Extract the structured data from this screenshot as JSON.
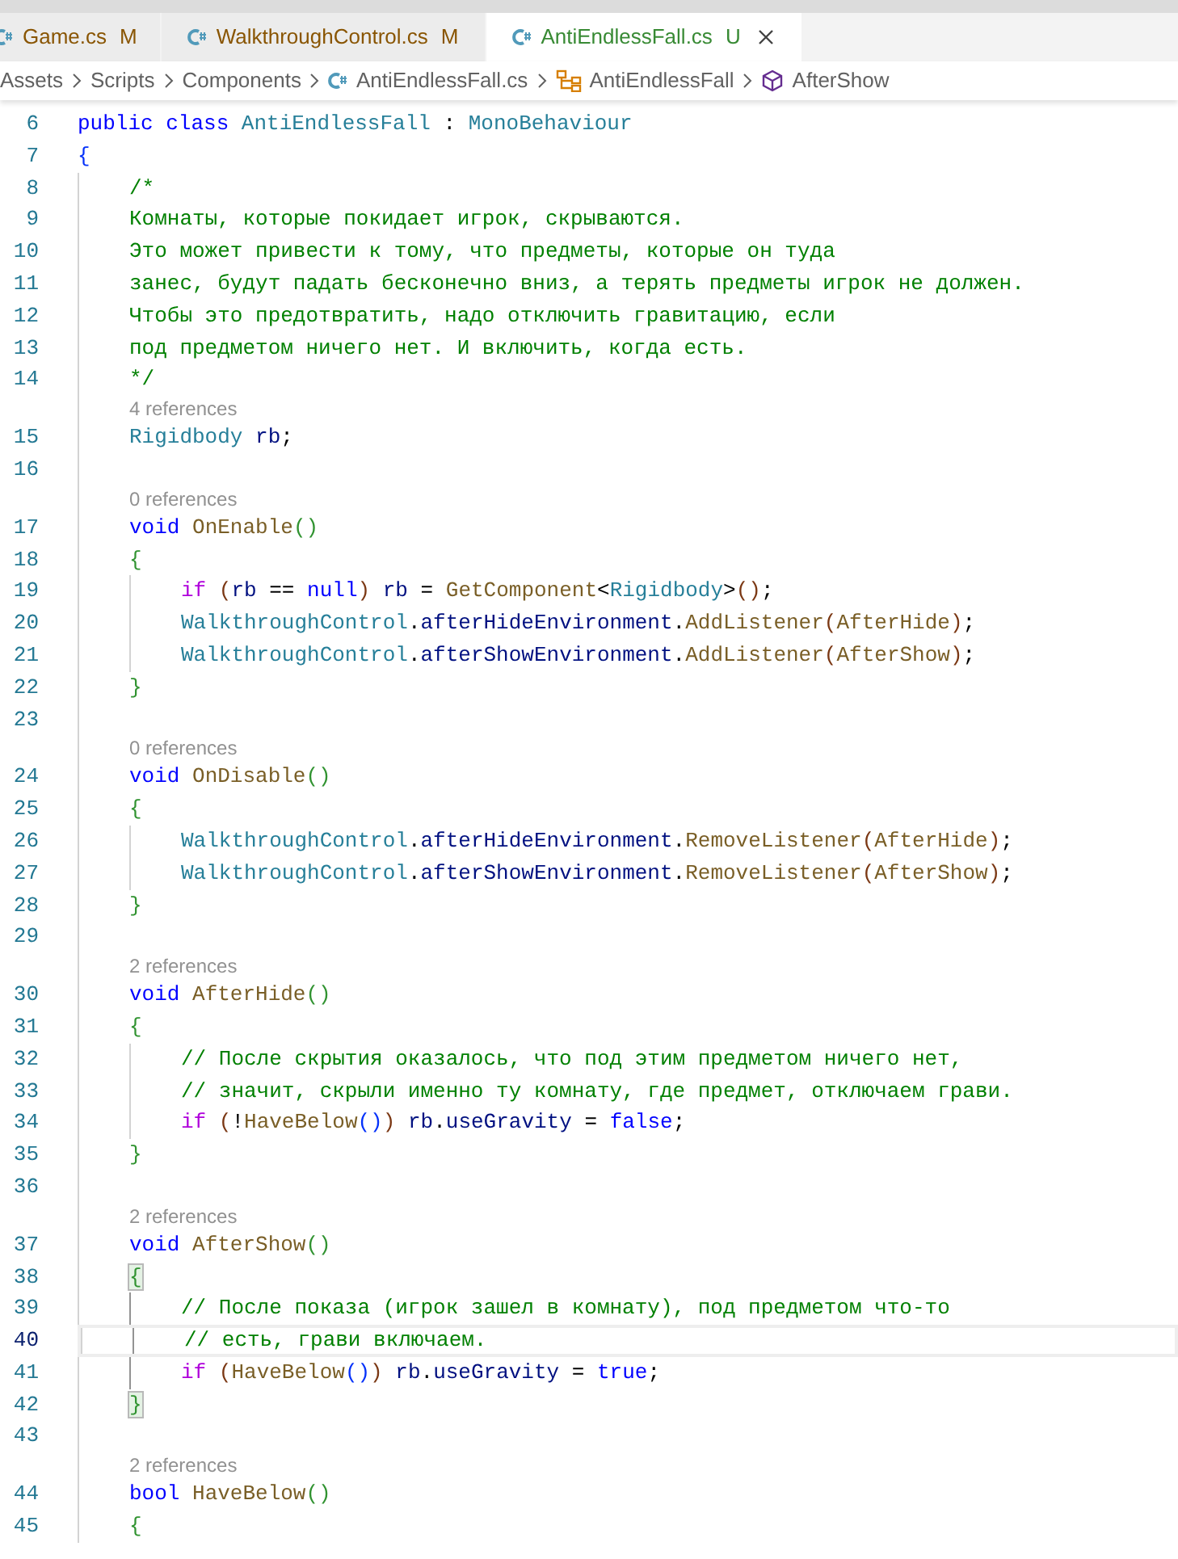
{
  "tabs": [
    {
      "label": "Game.cs",
      "status": "M",
      "kind": "modified",
      "selected": false
    },
    {
      "label": "WalkthroughControl.cs",
      "status": "M",
      "kind": "modified",
      "selected": false
    },
    {
      "label": "AntiEndlessFall.cs",
      "status": "U",
      "kind": "untracked",
      "selected": true
    }
  ],
  "breadcrumb": [
    {
      "label": "Assets",
      "kind": "folder"
    },
    {
      "label": "Scripts",
      "kind": "folder"
    },
    {
      "label": "Components",
      "kind": "folder"
    },
    {
      "label": "AntiEndlessFall.cs",
      "kind": "file"
    },
    {
      "label": "AntiEndlessFall",
      "kind": "class"
    },
    {
      "label": "AfterShow",
      "kind": "method"
    }
  ],
  "lines": [
    {
      "n": "6",
      "tokens": [
        {
          "kind": "k",
          "text": "public "
        },
        {
          "kind": "k",
          "text": "class "
        },
        {
          "kind": "t",
          "text": "AntiEndlessFall"
        },
        {
          "kind": "p",
          "text": " : "
        },
        {
          "kind": "t",
          "text": "MonoBehaviour"
        }
      ]
    },
    {
      "n": "7",
      "tokens": [
        {
          "kind": "b1",
          "text": "{"
        }
      ],
      "children": [
        {
          "n": "8",
          "tokens": [
            {
              "kind": "m",
              "text": "/*"
            }
          ]
        },
        {
          "n": "9",
          "tokens": [
            {
              "kind": "m",
              "text": "Комнаты, которые покидает игрок, скрываются."
            }
          ]
        },
        {
          "n": "10",
          "tokens": [
            {
              "kind": "m",
              "text": "Это может привести к тому, что предметы, которые он туда"
            }
          ]
        },
        {
          "n": "11",
          "tokens": [
            {
              "kind": "m",
              "text": "занес, будут падать бесконечно вниз, а терять предметы игрок не должен."
            }
          ]
        },
        {
          "n": "12",
          "tokens": [
            {
              "kind": "m",
              "text": "Чтобы это предотвратить, надо отключить гравитацию, если"
            }
          ]
        },
        {
          "n": "13",
          "tokens": [
            {
              "kind": "m",
              "text": "под предметом ничего нет. И включить, когда есть."
            }
          ]
        },
        {
          "n": "14",
          "tokens": [
            {
              "kind": "m",
              "text": "*/"
            }
          ]
        },
        {
          "n": "15",
          "references": "4 references",
          "tokens": [
            {
              "kind": "t",
              "text": "Rigidbody "
            },
            {
              "kind": "v",
              "text": "rb"
            },
            {
              "kind": "p",
              "text": ";"
            }
          ]
        },
        {
          "n": "16"
        },
        {
          "n": "17",
          "references": "0 references",
          "tokens": [
            {
              "kind": "k",
              "text": "void "
            },
            {
              "kind": "f",
              "text": "OnEnable"
            },
            {
              "kind": "b2",
              "text": "()"
            }
          ]
        },
        {
          "n": "18",
          "tokens": [
            {
              "kind": "b2",
              "text": "{"
            }
          ],
          "children": [
            {
              "n": "19",
              "tokens": [
                {
                  "kind": "c",
                  "text": "if "
                },
                {
                  "kind": "b3",
                  "text": "("
                },
                {
                  "kind": "v",
                  "text": "rb"
                },
                {
                  "kind": "p",
                  "text": " == "
                },
                {
                  "kind": "k",
                  "text": "null"
                },
                {
                  "kind": "b3",
                  "text": ") "
                },
                {
                  "kind": "v",
                  "text": "rb"
                },
                {
                  "kind": "p",
                  "text": " = "
                },
                {
                  "kind": "f",
                  "text": "GetComponent"
                },
                {
                  "kind": "p",
                  "text": "<"
                },
                {
                  "kind": "t",
                  "text": "Rigidbody"
                },
                {
                  "kind": "p",
                  "text": ">"
                },
                {
                  "kind": "b3",
                  "text": "()"
                },
                {
                  "kind": "p",
                  "text": ";"
                }
              ]
            },
            {
              "n": "20",
              "tokens": [
                {
                  "kind": "t",
                  "text": "WalkthroughControl"
                },
                {
                  "kind": "p",
                  "text": "."
                },
                {
                  "kind": "v",
                  "text": "afterHideEnvironment"
                },
                {
                  "kind": "p",
                  "text": "."
                },
                {
                  "kind": "f",
                  "text": "AddListener"
                },
                {
                  "kind": "b3",
                  "text": "("
                },
                {
                  "kind": "f",
                  "text": "AfterHide"
                },
                {
                  "kind": "b3",
                  "text": ")"
                },
                {
                  "kind": "p",
                  "text": ";"
                }
              ]
            },
            {
              "n": "21",
              "tokens": [
                {
                  "kind": "t",
                  "text": "WalkthroughControl"
                },
                {
                  "kind": "p",
                  "text": "."
                },
                {
                  "kind": "v",
                  "text": "afterShowEnvironment"
                },
                {
                  "kind": "p",
                  "text": "."
                },
                {
                  "kind": "f",
                  "text": "AddListener"
                },
                {
                  "kind": "b3",
                  "text": "("
                },
                {
                  "kind": "f",
                  "text": "AfterShow"
                },
                {
                  "kind": "b3",
                  "text": ")"
                },
                {
                  "kind": "p",
                  "text": ";"
                }
              ]
            }
          ]
        },
        {
          "n": "22",
          "tokens": [
            {
              "kind": "b2",
              "text": "}"
            }
          ]
        },
        {
          "n": "23"
        },
        {
          "n": "24",
          "references": "0 references",
          "tokens": [
            {
              "kind": "k",
              "text": "void "
            },
            {
              "kind": "f",
              "text": "OnDisable"
            },
            {
              "kind": "b2",
              "text": "()"
            }
          ]
        },
        {
          "n": "25",
          "tokens": [
            {
              "kind": "b2",
              "text": "{"
            }
          ],
          "children": [
            {
              "n": "26",
              "tokens": [
                {
                  "kind": "t",
                  "text": "WalkthroughControl"
                },
                {
                  "kind": "p",
                  "text": "."
                },
                {
                  "kind": "v",
                  "text": "afterHideEnvironment"
                },
                {
                  "kind": "p",
                  "text": "."
                },
                {
                  "kind": "f",
                  "text": "RemoveListener"
                },
                {
                  "kind": "b3",
                  "text": "("
                },
                {
                  "kind": "f",
                  "text": "AfterHide"
                },
                {
                  "kind": "b3",
                  "text": ")"
                },
                {
                  "kind": "p",
                  "text": ";"
                }
              ]
            },
            {
              "n": "27",
              "tokens": [
                {
                  "kind": "t",
                  "text": "WalkthroughControl"
                },
                {
                  "kind": "p",
                  "text": "."
                },
                {
                  "kind": "v",
                  "text": "afterShowEnvironment"
                },
                {
                  "kind": "p",
                  "text": "."
                },
                {
                  "kind": "f",
                  "text": "RemoveListener"
                },
                {
                  "kind": "b3",
                  "text": "("
                },
                {
                  "kind": "f",
                  "text": "AfterShow"
                },
                {
                  "kind": "b3",
                  "text": ")"
                },
                {
                  "kind": "p",
                  "text": ";"
                }
              ]
            }
          ]
        },
        {
          "n": "28",
          "tokens": [
            {
              "kind": "b2",
              "text": "}"
            }
          ]
        },
        {
          "n": "29"
        },
        {
          "n": "30",
          "references": "2 references",
          "tokens": [
            {
              "kind": "k",
              "text": "void "
            },
            {
              "kind": "f",
              "text": "AfterHide"
            },
            {
              "kind": "b2",
              "text": "()"
            }
          ]
        },
        {
          "n": "31",
          "tokens": [
            {
              "kind": "b2",
              "text": "{"
            }
          ],
          "children": [
            {
              "n": "32",
              "tokens": [
                {
                  "kind": "m",
                  "text": "// После скрытия оказалось, что под этим предметом ничего нет,"
                }
              ]
            },
            {
              "n": "33",
              "tokens": [
                {
                  "kind": "m",
                  "text": "// значит, скрыли именно ту комнату, где предмет, отключаем грави."
                }
              ]
            },
            {
              "n": "34",
              "tokens": [
                {
                  "kind": "c",
                  "text": "if "
                },
                {
                  "kind": "b3",
                  "text": "("
                },
                {
                  "kind": "p",
                  "text": "!"
                },
                {
                  "kind": "f",
                  "text": "HaveBelow"
                },
                {
                  "kind": "b1",
                  "text": "()"
                },
                {
                  "kind": "b3",
                  "text": ") "
                },
                {
                  "kind": "v",
                  "text": "rb"
                },
                {
                  "kind": "p",
                  "text": "."
                },
                {
                  "kind": "v",
                  "text": "useGravity"
                },
                {
                  "kind": "p",
                  "text": " = "
                },
                {
                  "kind": "k",
                  "text": "false"
                },
                {
                  "kind": "p",
                  "text": ";"
                }
              ]
            }
          ]
        },
        {
          "n": "35",
          "tokens": [
            {
              "kind": "b2",
              "text": "}"
            }
          ]
        },
        {
          "n": "36"
        },
        {
          "n": "37",
          "references": "2 references",
          "tokens": [
            {
              "kind": "k",
              "text": "void "
            },
            {
              "kind": "f",
              "text": "AfterShow"
            },
            {
              "kind": "b2",
              "text": "()"
            }
          ]
        },
        {
          "n": "38",
          "active": true,
          "tokens": [
            {
              "kind": "b2match",
              "text": "{"
            }
          ],
          "children": [
            {
              "n": "39",
              "tokens": [
                {
                  "kind": "m",
                  "text": "// После показа (игрок зашел в комнату), под предметом что-то"
                }
              ]
            },
            {
              "n": "40",
              "current": true,
              "tokens": [
                {
                  "kind": "m",
                  "text": "// есть, грави включаем."
                }
              ]
            },
            {
              "n": "41",
              "tokens": [
                {
                  "kind": "c",
                  "text": "if "
                },
                {
                  "kind": "b3",
                  "text": "("
                },
                {
                  "kind": "f",
                  "text": "HaveBelow"
                },
                {
                  "kind": "b1",
                  "text": "()"
                },
                {
                  "kind": "b3",
                  "text": ") "
                },
                {
                  "kind": "v",
                  "text": "rb"
                },
                {
                  "kind": "p",
                  "text": "."
                },
                {
                  "kind": "v",
                  "text": "useGravity"
                },
                {
                  "kind": "p",
                  "text": " = "
                },
                {
                  "kind": "k",
                  "text": "true"
                },
                {
                  "kind": "p",
                  "text": ";"
                }
              ]
            }
          ]
        },
        {
          "n": "42",
          "tokens": [
            {
              "kind": "b2match",
              "text": "}"
            }
          ]
        },
        {
          "n": "43"
        },
        {
          "n": "44",
          "references": "2 references",
          "tokens": [
            {
              "kind": "k",
              "text": "bool "
            },
            {
              "kind": "f",
              "text": "HaveBelow"
            },
            {
              "kind": "b2",
              "text": "()"
            }
          ]
        },
        {
          "n": "45",
          "tokens": [
            {
              "kind": "b2",
              "text": "{"
            }
          ]
        }
      ]
    }
  ]
}
